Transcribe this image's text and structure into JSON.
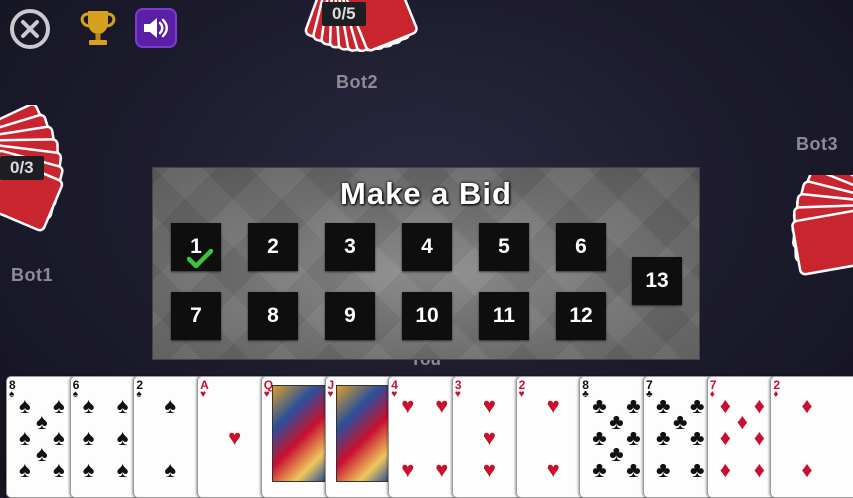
{
  "toolbar": {
    "close_icon": "close-icon",
    "trophy_icon": "trophy-icon",
    "sound_icon": "speaker-icon",
    "sound_bg": "#5b1fa6"
  },
  "opponents": [
    {
      "name": "Bot1",
      "score": "0/3"
    },
    {
      "name": "Bot2",
      "score": "0/5"
    },
    {
      "name": "Bot3",
      "score": ""
    }
  ],
  "bid_panel": {
    "title": "Make a Bid",
    "options": [
      "1",
      "2",
      "3",
      "4",
      "5",
      "6",
      "7",
      "8",
      "9",
      "10",
      "11",
      "12",
      "13"
    ],
    "selected": "1"
  },
  "player": {
    "label": "You",
    "hand": [
      {
        "rank": "8",
        "suit": "♠",
        "color": "black"
      },
      {
        "rank": "6",
        "suit": "♠",
        "color": "black"
      },
      {
        "rank": "2",
        "suit": "♠",
        "color": "black"
      },
      {
        "rank": "A",
        "suit": "♥",
        "color": "red"
      },
      {
        "rank": "Q",
        "suit": "♥",
        "color": "red"
      },
      {
        "rank": "J",
        "suit": "♥",
        "color": "red"
      },
      {
        "rank": "4",
        "suit": "♥",
        "color": "red"
      },
      {
        "rank": "3",
        "suit": "♥",
        "color": "red"
      },
      {
        "rank": "2",
        "suit": "♥",
        "color": "red"
      },
      {
        "rank": "8",
        "suit": "♣",
        "color": "black"
      },
      {
        "rank": "7",
        "suit": "♣",
        "color": "black"
      },
      {
        "rank": "7",
        "suit": "♦",
        "color": "red"
      },
      {
        "rank": "2",
        "suit": "♦",
        "color": "red"
      }
    ]
  },
  "colors": {
    "card_back": "#c8252f",
    "panel": "#7a7a7a",
    "check": "#3cc43c"
  }
}
